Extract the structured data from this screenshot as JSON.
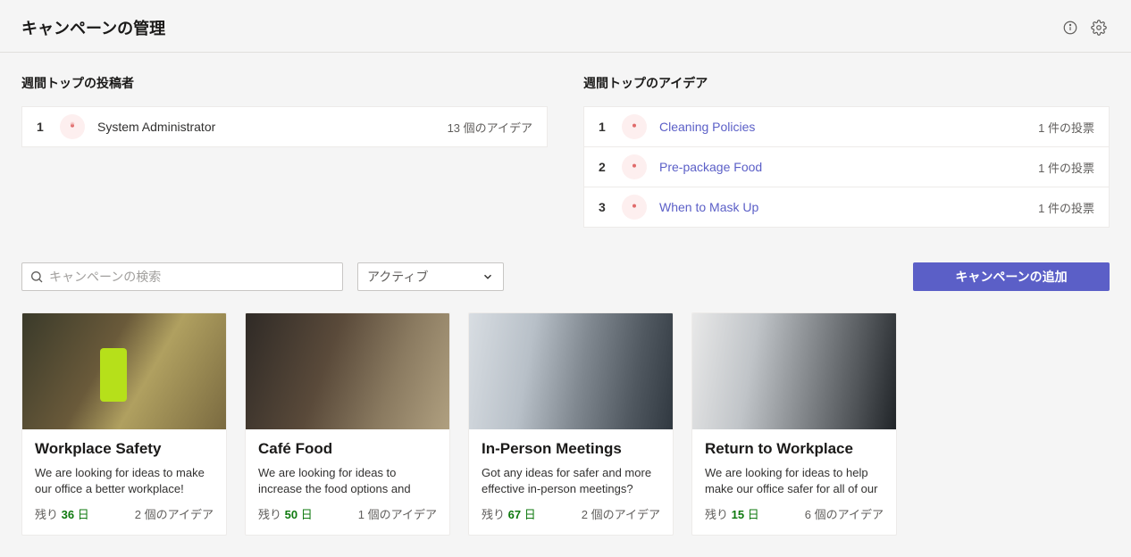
{
  "header": {
    "title": "キャンペーンの管理"
  },
  "contributors": {
    "title": "週間トップの投稿者",
    "rows": [
      {
        "rank": "1",
        "name": "System Administrator",
        "stat": "13 個のアイデア"
      }
    ]
  },
  "ideas": {
    "title": "週間トップのアイデア",
    "rows": [
      {
        "rank": "1",
        "name": "Cleaning Policies",
        "stat": "1 件の投票"
      },
      {
        "rank": "2",
        "name": "Pre-package Food",
        "stat": "1 件の投票"
      },
      {
        "rank": "3",
        "name": "When to Mask Up",
        "stat": "1 件の投票"
      }
    ]
  },
  "toolbar": {
    "search_placeholder": "キャンペーンの検索",
    "filter_label": "アクティブ",
    "add_label": "キャンペーンの追加"
  },
  "labels": {
    "remaining_prefix": "残り",
    "days_suffix": "日"
  },
  "campaigns": [
    {
      "title": "Workplace Safety",
      "desc": "We are looking for ideas to make our office a better workplace!",
      "days": "36",
      "ideas": "2 個のアイデア"
    },
    {
      "title": "Café Food",
      "desc": "We are looking for ideas to increase the food options and improve in",
      "days": "50",
      "ideas": "1 個のアイデア"
    },
    {
      "title": "In-Person Meetings",
      "desc": "Got any ideas for safer and more effective in-person meetings?",
      "days": "67",
      "ideas": "2 個のアイデア"
    },
    {
      "title": "Return to Workplace",
      "desc": "We are looking for ideas to help make our office safer for all of our",
      "days": "15",
      "ideas": "6 個のアイデア"
    }
  ]
}
